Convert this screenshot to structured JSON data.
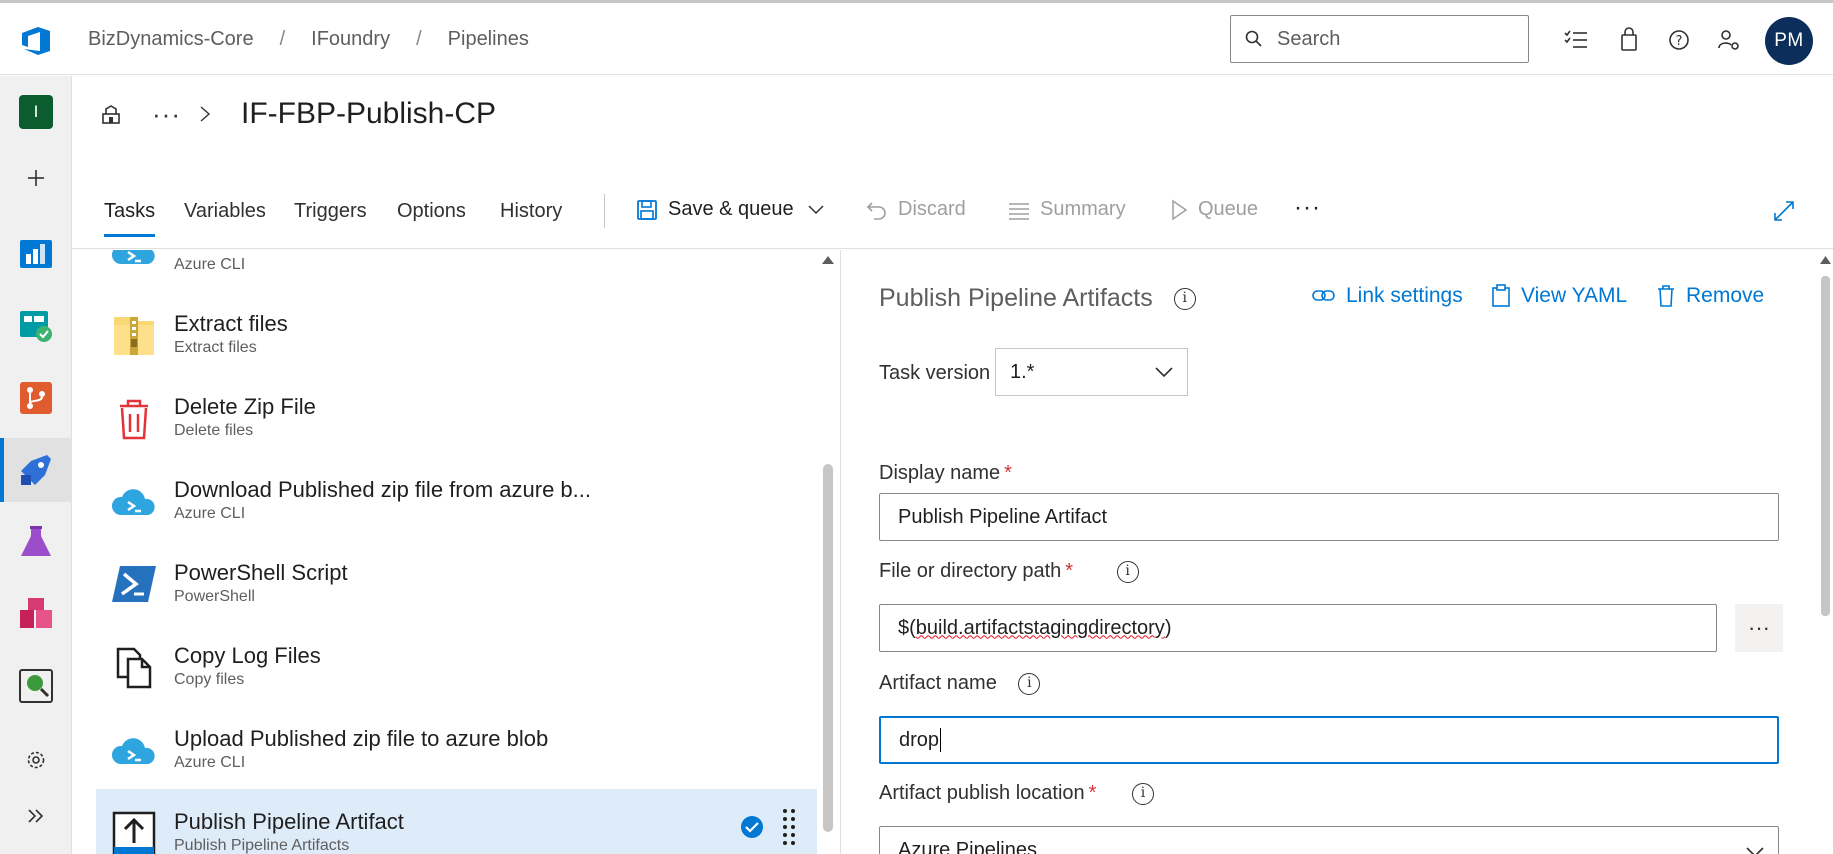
{
  "header": {
    "breadcrumbs": [
      "BizDynamics-Core",
      "IFoundry",
      "Pipelines"
    ],
    "search_placeholder": "Search",
    "avatar_initials": "PM"
  },
  "rail": {
    "org_initial": "I",
    "icons": [
      "plus-icon",
      "boards-icon",
      "test-plans-icon",
      "repos-icon",
      "pipelines-icon",
      "test-flask-icon",
      "artifacts-icon",
      "search-insights-icon",
      "settings-icon",
      "expand-icon"
    ]
  },
  "page": {
    "title": "IF-FBP-Publish-CP",
    "more": "···"
  },
  "toolbar": {
    "tabs": [
      "Tasks",
      "Variables",
      "Triggers",
      "Options",
      "History"
    ],
    "active_tab": "Tasks",
    "save_queue": "Save & queue",
    "discard": "Discard",
    "summary": "Summary",
    "queue": "Queue",
    "more": "···"
  },
  "tasks": [
    {
      "name": "",
      "sub": "Azure CLI",
      "icon": "azure-cli-icon"
    },
    {
      "name": "Extract files",
      "sub": "Extract files",
      "icon": "zip-icon"
    },
    {
      "name": "Delete Zip File",
      "sub": "Delete files",
      "icon": "trash-icon"
    },
    {
      "name": "Download Published zip file from azure b...",
      "sub": "Azure CLI",
      "icon": "azure-cli-icon"
    },
    {
      "name": "PowerShell Script",
      "sub": "PowerShell",
      "icon": "powershell-icon"
    },
    {
      "name": "Copy Log Files",
      "sub": "Copy files",
      "icon": "copy-files-icon"
    },
    {
      "name": "Upload Published zip file to azure blob",
      "sub": "Azure CLI",
      "icon": "azure-cli-icon"
    },
    {
      "name": "Publish Pipeline Artifact",
      "sub": "Publish Pipeline Artifacts",
      "icon": "publish-artifact-icon",
      "selected": true
    }
  ],
  "panel": {
    "title": "Publish Pipeline Artifacts",
    "link_settings": "Link settings",
    "view_yaml": "View YAML",
    "remove": "Remove",
    "task_version_label": "Task version",
    "task_version_value": "1.*",
    "display_name_label": "Display name",
    "display_name_value": "Publish Pipeline Artifact",
    "path_label": "File or directory path",
    "path_prefix": "$(",
    "path_body": "build.artifactstagingdirectory",
    "path_suffix": ")",
    "artifact_name_label": "Artifact name",
    "artifact_name_value": "drop",
    "publish_location_label": "Artifact publish location",
    "publish_location_value": "Azure Pipelines",
    "required_mark": "*",
    "info_glyph": "i",
    "ellipsis": "···"
  },
  "colors": {
    "accent": "#0078d4",
    "selected_row": "#deecf9",
    "required": "#d13438"
  }
}
